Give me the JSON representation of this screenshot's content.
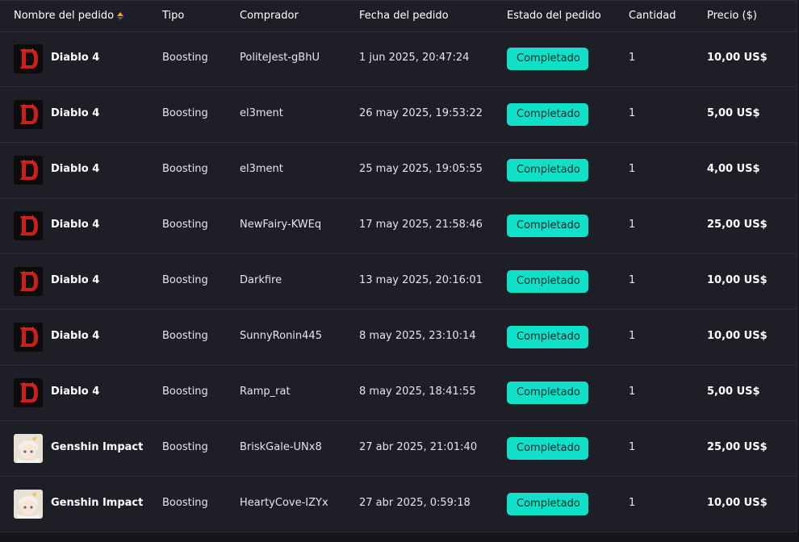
{
  "columns": {
    "name": "Nombre del pedido",
    "type": "Tipo",
    "buyer": "Comprador",
    "date": "Fecha del pedido",
    "status": "Estado del pedido",
    "quantity": "Cantidad",
    "price": "Precio ($)"
  },
  "colors": {
    "status_badge": "#11e0c9",
    "diablo_icon": "#c8211b",
    "background": "#1e1f26"
  },
  "orders": [
    {
      "game": "Diablo 4",
      "icon": "diablo-icon",
      "type": "Boosting",
      "buyer": "PoliteJest-gBhU",
      "date": "1 jun 2025, 20:47:24",
      "status": "Completado",
      "quantity": "1",
      "price": "10,00 US$"
    },
    {
      "game": "Diablo 4",
      "icon": "diablo-icon",
      "type": "Boosting",
      "buyer": "el3ment",
      "date": "26 may 2025, 19:53:22",
      "status": "Completado",
      "quantity": "1",
      "price": "5,00 US$"
    },
    {
      "game": "Diablo 4",
      "icon": "diablo-icon",
      "type": "Boosting",
      "buyer": "el3ment",
      "date": "25 may 2025, 19:05:55",
      "status": "Completado",
      "quantity": "1",
      "price": "4,00 US$"
    },
    {
      "game": "Diablo 4",
      "icon": "diablo-icon",
      "type": "Boosting",
      "buyer": "NewFairy-KWEq",
      "date": "17 may 2025, 21:58:46",
      "status": "Completado",
      "quantity": "1",
      "price": "25,00 US$"
    },
    {
      "game": "Diablo 4",
      "icon": "diablo-icon",
      "type": "Boosting",
      "buyer": "Darkfire",
      "date": "13 may 2025, 20:16:01",
      "status": "Completado",
      "quantity": "1",
      "price": "10,00 US$"
    },
    {
      "game": "Diablo 4",
      "icon": "diablo-icon",
      "type": "Boosting",
      "buyer": "SunnyRonin445",
      "date": "8 may 2025, 23:10:14",
      "status": "Completado",
      "quantity": "1",
      "price": "10,00 US$"
    },
    {
      "game": "Diablo 4",
      "icon": "diablo-icon",
      "type": "Boosting",
      "buyer": "Ramp_rat",
      "date": "8 may 2025, 18:41:55",
      "status": "Completado",
      "quantity": "1",
      "price": "5,00 US$"
    },
    {
      "game": "Genshin Impact",
      "icon": "genshin-icon",
      "type": "Boosting",
      "buyer": "BriskGale-UNx8",
      "date": "27 abr 2025, 21:01:40",
      "status": "Completado",
      "quantity": "1",
      "price": "25,00 US$"
    },
    {
      "game": "Genshin Impact",
      "icon": "genshin-icon",
      "type": "Boosting",
      "buyer": "HeartyCove-IZYx",
      "date": "27 abr 2025, 0:59:18",
      "status": "Completado",
      "quantity": "1",
      "price": "10,00 US$"
    }
  ]
}
